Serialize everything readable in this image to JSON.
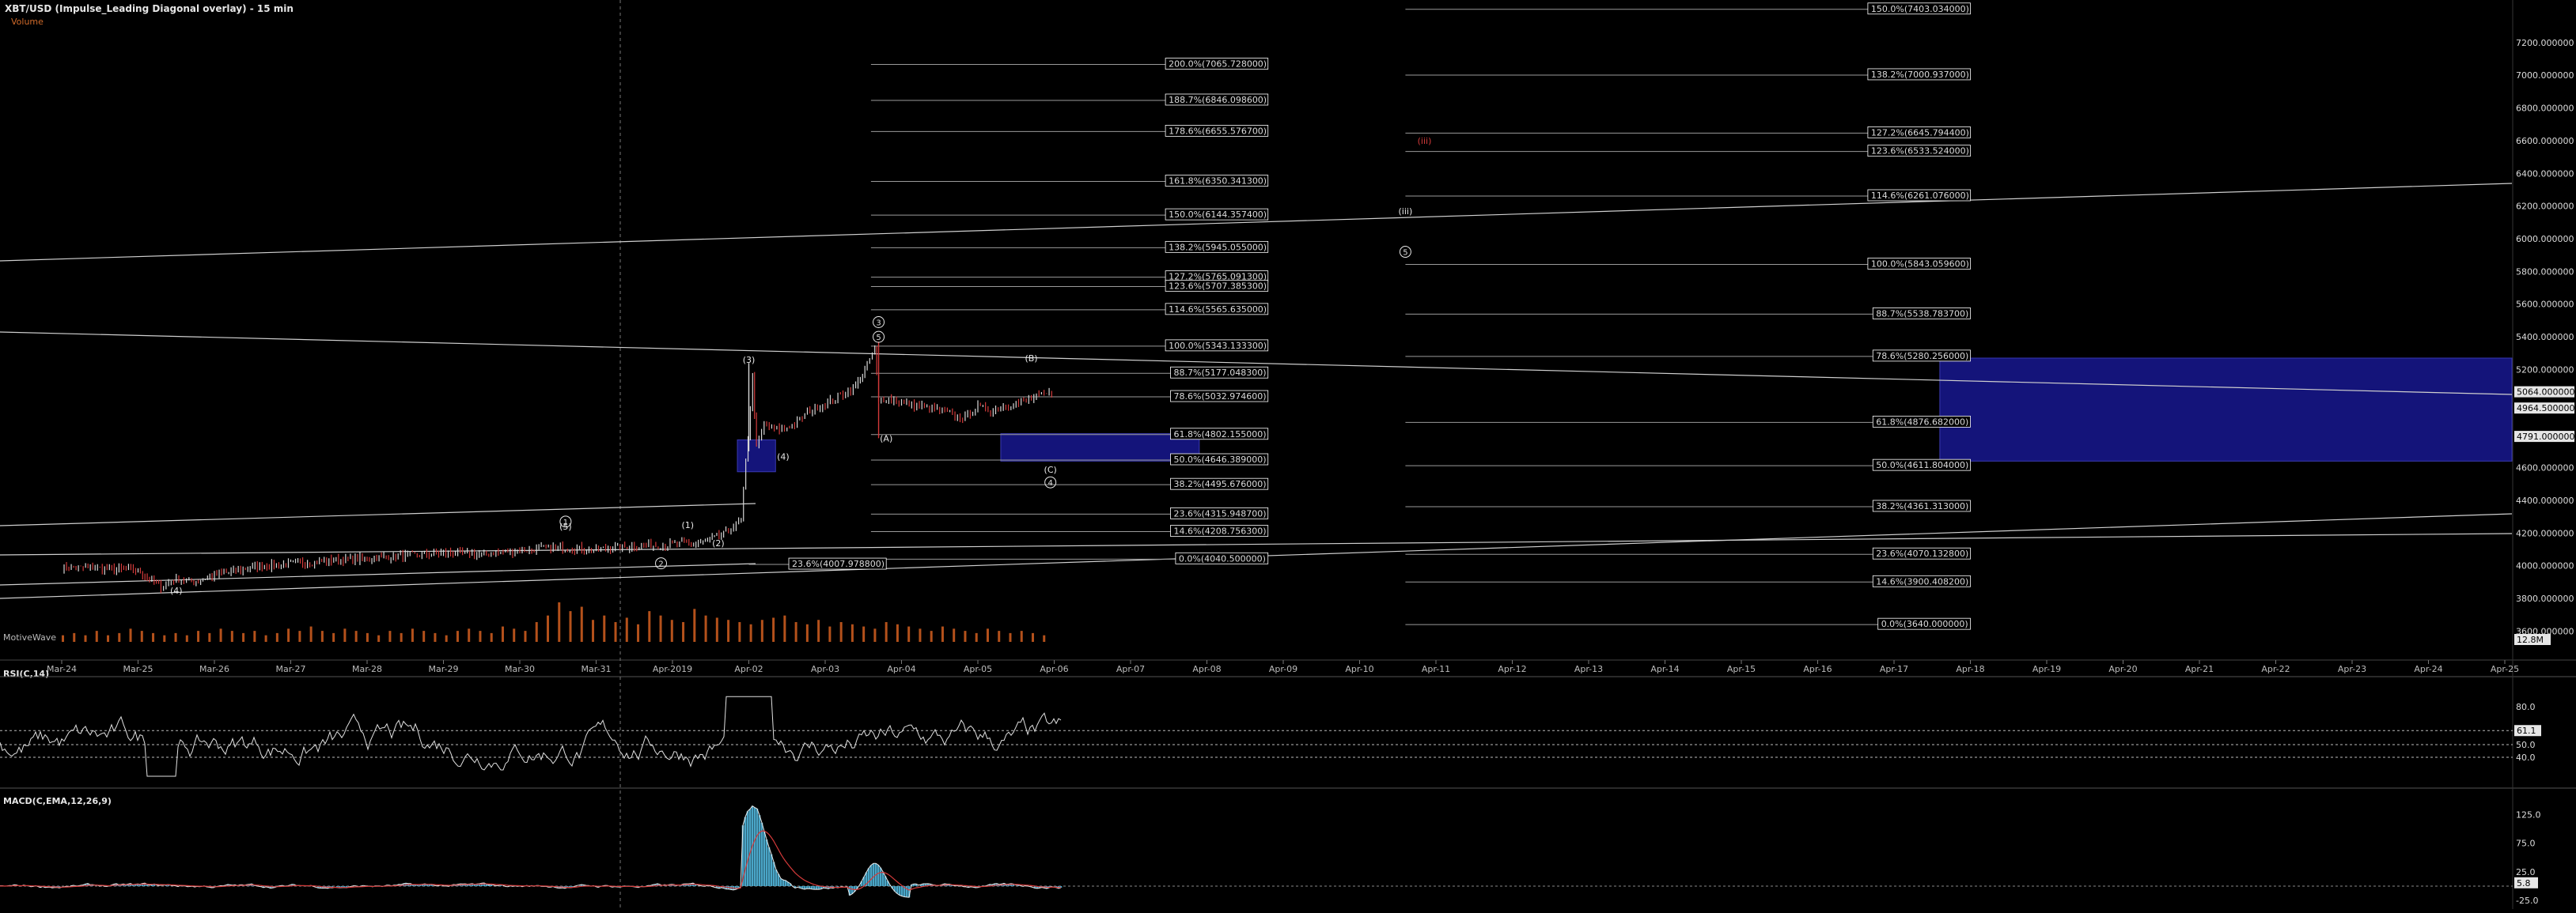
{
  "header": {
    "symbol_title": "XBT/USD (Impulse_Leading Diagonal overlay) - 15 min",
    "volume_label": "Volume",
    "watermark": "MotiveWave"
  },
  "colors": {
    "background": "#000000",
    "fib_line": "#9a9a9a",
    "fib_box": "#ffffff",
    "zone": "#14147a",
    "price_line": "#d0d0d0",
    "candle_up": "#d8d8d8",
    "candle_down": "#d43a3a",
    "volume": "#c85a1e",
    "macd_fill": "#4aa6c8",
    "signal": "#d43a3a"
  },
  "chart_data": [
    {
      "type": "candlestick",
      "panel": "price",
      "title": "XBT/USD (Impulse_Leading Diagonal overlay) - 15 min",
      "x_tick_labels": [
        "Mar-24",
        "Mar-25",
        "Mar-26",
        "Mar-27",
        "Mar-28",
        "Mar-29",
        "Mar-30",
        "Mar-31",
        "Apr-2019",
        "Apr-02",
        "Apr-03",
        "Apr-04",
        "Apr-05",
        "Apr-06",
        "Apr-07",
        "Apr-08",
        "Apr-09",
        "Apr-10",
        "Apr-11",
        "Apr-12",
        "Apr-13",
        "Apr-14",
        "Apr-15",
        "Apr-16",
        "Apr-17",
        "Apr-18",
        "Apr-19",
        "Apr-20",
        "Apr-21",
        "Apr-22",
        "Apr-23",
        "Apr-24",
        "Apr-25"
      ],
      "y_tick_labels": [
        "7200.000000",
        "7000.000000",
        "6800.000000",
        "6600.000000",
        "6400.000000",
        "6200.000000",
        "6000.000000",
        "5800.000000",
        "5600.000000",
        "5400.000000",
        "5200.000000",
        "4800.000000",
        "4600.000000",
        "4400.000000",
        "4200.000000",
        "4000.000000",
        "3800.000000",
        "3600.000000"
      ],
      "ylim": [
        3520,
        7460
      ],
      "current_price_labels": [
        "5064.000000",
        "4964.500000",
        "4791.000000"
      ],
      "volume_axis_label": "12.8M",
      "close_path": {
        "x_day_offset_from_mar24": [
          0,
          0.5,
          1.0,
          1.3,
          1.5,
          1.7,
          2.0,
          2.5,
          3.0,
          3.5,
          4.0,
          4.5,
          5.0,
          5.5,
          6.0,
          6.5,
          7.0,
          7.5,
          8.0,
          8.4,
          8.7,
          8.9,
          9.05,
          9.1,
          9.2,
          9.4,
          9.6,
          9.8,
          10.0,
          10.2,
          10.4,
          10.55,
          10.65,
          10.7,
          10.8,
          10.9,
          11.0,
          11.2,
          11.4,
          11.6,
          11.8,
          12.0,
          12.2,
          12.4,
          12.6,
          12.8,
          13.0
        ],
        "y": [
          3990,
          3985,
          3970,
          3870,
          3920,
          3900,
          3940,
          3990,
          4015,
          4030,
          4045,
          4060,
          4080,
          4070,
          4095,
          4110,
          4100,
          4120,
          4130,
          4140,
          4200,
          4280,
          5150,
          4720,
          4860,
          4830,
          4870,
          4950,
          4990,
          5040,
          5100,
          5230,
          5320,
          5000,
          5030,
          5010,
          4990,
          4980,
          4960,
          4940,
          4900,
          4970,
          4950,
          4990,
          5000,
          5040,
          5060
        ]
      },
      "volume_values": [
        3,
        4,
        3,
        5,
        3,
        4,
        6,
        5,
        4,
        3,
        4,
        3,
        5,
        4,
        6,
        5,
        4,
        5,
        3,
        4,
        6,
        5,
        7,
        5,
        4,
        6,
        5,
        4,
        3,
        5,
        4,
        6,
        5,
        4,
        3,
        5,
        6,
        5,
        4,
        7,
        6,
        5,
        9,
        12,
        18,
        14,
        16,
        10,
        12,
        9,
        11,
        8,
        14,
        12,
        10,
        9,
        15,
        12,
        11,
        10,
        9,
        8,
        10,
        11,
        12,
        9,
        8,
        10,
        7,
        9,
        8,
        7,
        6,
        9,
        8,
        7,
        6,
        5,
        7,
        6,
        5,
        4,
        6,
        5,
        4,
        5,
        4,
        3
      ]
    },
    {
      "type": "fibonacci_levels",
      "panel": "price",
      "sets": [
        {
          "name": "left",
          "x_start_day": 10.6,
          "x_end_day": 15.8,
          "levels": [
            {
              "label": "200.0%(7065.728000)",
              "y": 7065.728
            },
            {
              "label": "188.7%(6846.098600)",
              "y": 6846.0986
            },
            {
              "label": "178.6%(6655.576700)",
              "y": 6655.5767
            },
            {
              "label": "161.8%(6350.341300)",
              "y": 6350.3413
            },
            {
              "label": "150.0%(6144.357400)",
              "y": 6144.3574
            },
            {
              "label": "138.2%(5945.055000)",
              "y": 5945.055
            },
            {
              "label": "127.2%(5765.091300)",
              "y": 5765.0913
            },
            {
              "label": "123.6%(5707.385300)",
              "y": 5707.3853
            },
            {
              "label": "114.6%(5565.635000)",
              "y": 5565.635
            },
            {
              "label": "100.0%(5343.133300)",
              "y": 5343.1333
            },
            {
              "label": "88.7%(5177.048300)",
              "y": 5177.0483
            },
            {
              "label": "78.6%(5032.974600)",
              "y": 5032.9746
            },
            {
              "label": "61.8%(4802.155000)",
              "y": 4802.155
            },
            {
              "label": "50.0%(4646.389000)",
              "y": 4646.389
            },
            {
              "label": "38.2%(4495.676000)",
              "y": 4495.676
            },
            {
              "label": "23.6%(4315.948700)",
              "y": 4315.9487
            },
            {
              "label": "14.6%(4208.756300)",
              "y": 4208.7563
            },
            {
              "label": "0.0%(4040.500000)",
              "y": 4040.5
            }
          ]
        },
        {
          "name": "right",
          "x_start_day": 17.6,
          "x_end_day": 25.0,
          "levels": [
            {
              "label": "150.0%(7403.034000)",
              "y": 7403.034
            },
            {
              "label": "138.2%(7000.937000)",
              "y": 7000.937
            },
            {
              "label": "127.2%(6645.794400)",
              "y": 6645.7944
            },
            {
              "label": "123.6%(6533.524000)",
              "y": 6533.524
            },
            {
              "label": "114.6%(6261.076000)",
              "y": 6261.076
            },
            {
              "label": "100.0%(5843.059600)",
              "y": 5843.0596
            },
            {
              "label": "88.7%(5538.783700)",
              "y": 5538.7837
            },
            {
              "label": "78.6%(5280.256000)",
              "y": 5280.256
            },
            {
              "label": "61.8%(4876.682000)",
              "y": 4876.682
            },
            {
              "label": "50.0%(4611.804000)",
              "y": 4611.804
            },
            {
              "label": "38.2%(4361.313000)",
              "y": 4361.313
            },
            {
              "label": "23.6%(4070.132800)",
              "y": 4070.1328
            },
            {
              "label": "14.6%(3900.408200)",
              "y": 3900.4082
            },
            {
              "label": "0.0%(3640.000000)",
              "y": 3640.0
            }
          ]
        },
        {
          "name": "small",
          "levels": [
            {
              "label": "23.6%(4007.978800)",
              "y": 4007.9788,
              "x_start_day": 9.0,
              "x_end_day": 10.8
            }
          ]
        }
      ],
      "zones": [
        {
          "x_start_day": 8.85,
          "x_end_day": 9.35,
          "y_top": 4770,
          "y_bottom": 4575
        },
        {
          "x_start_day": 12.3,
          "x_end_day": 14.9,
          "y_top": 4808,
          "y_bottom": 4640
        },
        {
          "x_start_day": 24.6,
          "x_end_day": 32.2,
          "y_top": 5270,
          "y_bottom": 4640
        }
      ],
      "wave_labels": [
        {
          "text": "(3)",
          "x_day": 9.0,
          "y": 5240
        },
        {
          "text": "(4)",
          "x_day": 9.45,
          "y": 4650
        },
        {
          "text": "(1)",
          "x_day": 8.2,
          "y": 4230
        },
        {
          "text": "(2)",
          "x_day": 8.6,
          "y": 4120
        },
        {
          "text": "(4)",
          "x_day": 1.5,
          "y": 3830
        },
        {
          "text": "(5)",
          "x_day": 6.6,
          "y": 4220
        },
        {
          "text": "(A)",
          "x_day": 10.8,
          "y": 4760
        },
        {
          "text": "(B)",
          "x_day": 12.7,
          "y": 5250
        },
        {
          "text": "(C)",
          "x_day": 12.95,
          "y": 4570
        },
        {
          "text": "(iii)",
          "x_day": 17.6,
          "y": 6150
        },
        {
          "text": "(iii)",
          "x_day": 17.85,
          "y": 6580
        }
      ],
      "circled_labels": [
        {
          "text": "1",
          "x_day": 6.6,
          "y": 4270
        },
        {
          "text": "2",
          "x_day": 7.85,
          "y": 4015
        },
        {
          "text": "3",
          "x_day": 10.7,
          "y": 5490
        },
        {
          "text": "5",
          "x_day": 10.7,
          "y": 5400
        },
        {
          "text": "4",
          "x_day": 12.95,
          "y": 4510
        },
        {
          "text": "5",
          "x_day": 17.6,
          "y": 5920
        }
      ]
    },
    {
      "type": "line",
      "panel": "rsi",
      "title": "RSI(C,14)",
      "y_tick_labels": [
        "80.0",
        "61.1",
        "50.0",
        "40.0"
      ],
      "ylim": [
        20,
        95
      ],
      "ref_lines": [
        61.1,
        50,
        40
      ],
      "current_value_label": "61.1"
    },
    {
      "type": "line",
      "panel": "macd",
      "title": "MACD(C,EMA,12,26,9)",
      "y_tick_labels": [
        "125.0",
        "75.0",
        "25.0",
        "5.8",
        "-25.0"
      ],
      "ylim": [
        -40,
        160
      ],
      "current_value_label": "5.8"
    }
  ]
}
